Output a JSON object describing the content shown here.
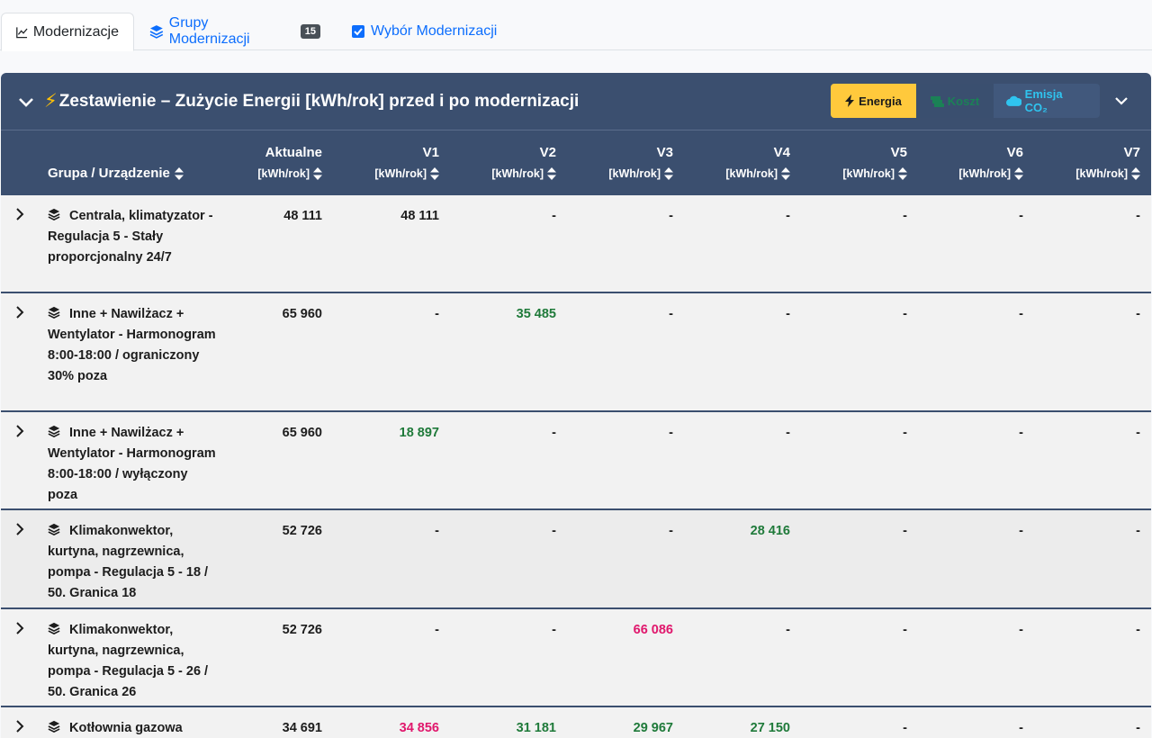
{
  "tabs": [
    {
      "label": "Modernizacje",
      "icon": "chart-line-icon",
      "active": true
    },
    {
      "label": "Grupy Modernizacji",
      "icon": "layers-icon",
      "badge": "15"
    },
    {
      "label": "Wybór Modernizacji",
      "icon": "checkbox-icon"
    }
  ],
  "header": {
    "title": "Zestawienie – Zużycie Energii [kWh/rok] przed i po modernizacji",
    "buttons": {
      "energia": "Energia",
      "koszt": "Koszt",
      "co2": "Emisja CO₂"
    }
  },
  "columns": [
    {
      "name": "Grupa / Urządzenie",
      "unit": ""
    },
    {
      "name": "Aktualne",
      "unit": "[kWh/rok]"
    },
    {
      "name": "V1",
      "unit": "[kWh/rok]"
    },
    {
      "name": "V2",
      "unit": "[kWh/rok]"
    },
    {
      "name": "V3",
      "unit": "[kWh/rok]"
    },
    {
      "name": "V4",
      "unit": "[kWh/rok]"
    },
    {
      "name": "V5",
      "unit": "[kWh/rok]"
    },
    {
      "name": "V6",
      "unit": "[kWh/rok]"
    },
    {
      "name": "V7",
      "unit": "[kWh/rok]"
    }
  ],
  "colors": {
    "accent": "#3b4f6f",
    "energia": "#ffc93c",
    "better": "#1f7a3a",
    "worse": "#e0176c"
  },
  "rows": [
    {
      "label": "Centrala, klimatyzator - Regulacja 5 - Stały proporcjonalny 24/7",
      "values": [
        "48 111",
        "48 111",
        "-",
        "-",
        "-",
        "-",
        "-",
        "-"
      ],
      "status": [
        "",
        "",
        "",
        "",
        "",
        "",
        "",
        ""
      ]
    },
    {
      "label": "Inne + Nawilżacz + Wentylator - Harmonogram 8:00-18:00 / ograniczony 30% poza",
      "values": [
        "65 960",
        "-",
        "35 485",
        "-",
        "-",
        "-",
        "-",
        "-"
      ],
      "status": [
        "",
        "",
        "green",
        "",
        "",
        "",
        "",
        ""
      ]
    },
    {
      "label": "Inne + Nawilżacz + Wentylator - Harmonogram 8:00-18:00 / wyłączony poza",
      "values": [
        "65 960",
        "18 897",
        "-",
        "-",
        "-",
        "-",
        "-",
        "-"
      ],
      "status": [
        "",
        "green",
        "",
        "",
        "",
        "",
        "",
        ""
      ]
    },
    {
      "label": "Klimakonwektor, kurtyna, nagrzewnica, pompa - Regulacja 5 - 18 / 50. Granica 18",
      "values": [
        "52 726",
        "-",
        "-",
        "-",
        "28 416",
        "-",
        "-",
        "-"
      ],
      "status": [
        "",
        "",
        "",
        "",
        "green",
        "",
        "",
        ""
      ]
    },
    {
      "label": "Klimakonwektor, kurtyna, nagrzewnica, pompa - Regulacja 5 - 26 / 50. Granica 26",
      "values": [
        "52 726",
        "-",
        "-",
        "66 086",
        "-",
        "-",
        "-",
        "-"
      ],
      "status": [
        "",
        "",
        "",
        "pink",
        "",
        "",
        "",
        ""
      ]
    },
    {
      "label": "Kotłownia gazowa",
      "values": [
        "34 691",
        "34 856",
        "31 181",
        "29 967",
        "27 150",
        "-",
        "-",
        "-"
      ],
      "status": [
        "",
        "pink",
        "green",
        "green",
        "green",
        "",
        "",
        ""
      ]
    }
  ]
}
